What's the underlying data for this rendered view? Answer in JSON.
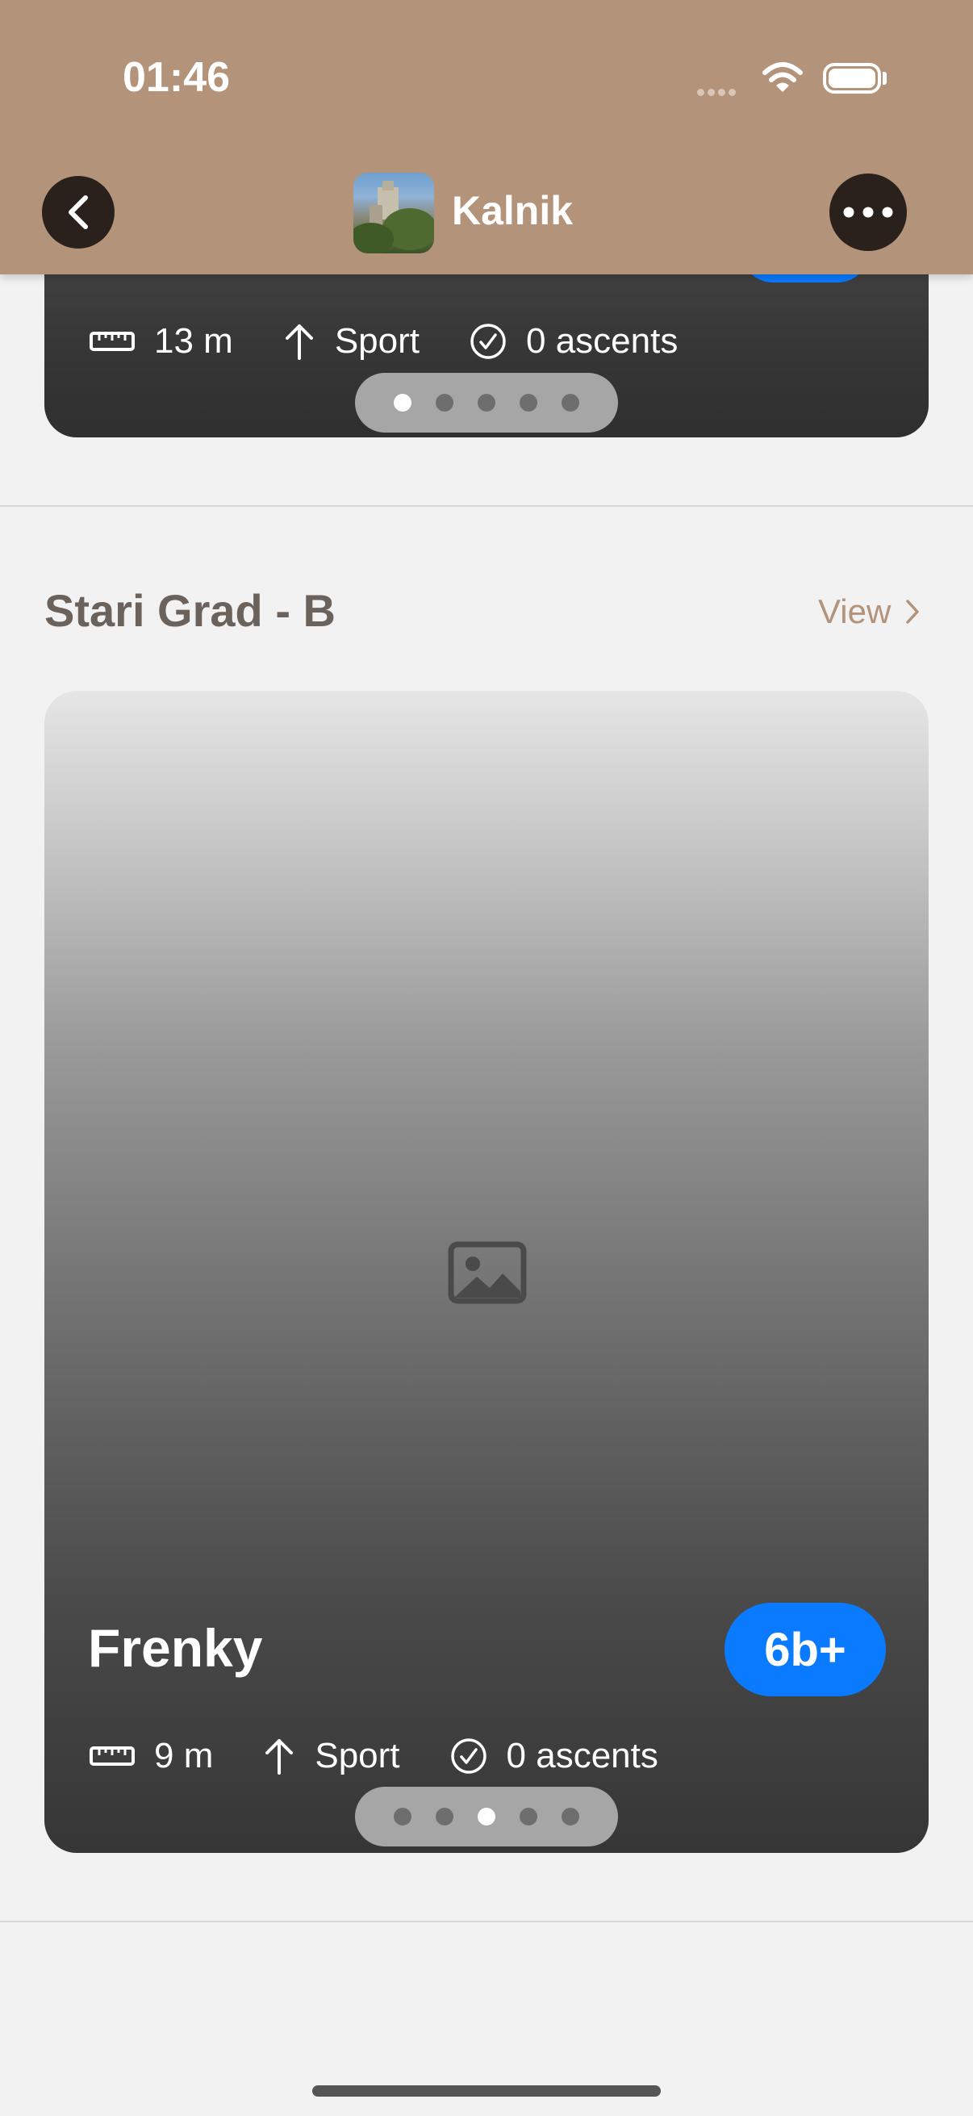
{
  "status_bar": {
    "time": "01:46"
  },
  "nav": {
    "title": "Kalnik"
  },
  "top_card": {
    "length": "13 m",
    "style": "Sport",
    "ascents": "0 ascents",
    "pager": {
      "count": 5,
      "active_index": 0
    }
  },
  "section": {
    "title": "Stari Grad - B",
    "view_label": "View"
  },
  "route_card": {
    "name": "Frenky",
    "grade": "6b+",
    "length": "9 m",
    "style": "Sport",
    "ascents": "0 ascents",
    "pager": {
      "count": 5,
      "active_index": 2
    }
  },
  "colors": {
    "header": "#b3937a",
    "accent_blue": "#0a7aff",
    "link": "#b3937a",
    "background": "#f2f2f2"
  },
  "icons": {
    "back": "chevron-left-icon",
    "more": "ellipsis-icon",
    "length": "ruler-icon",
    "style": "arrow-up-icon",
    "ascents": "checkmark-circle-icon",
    "placeholder": "image-placeholder-icon"
  }
}
